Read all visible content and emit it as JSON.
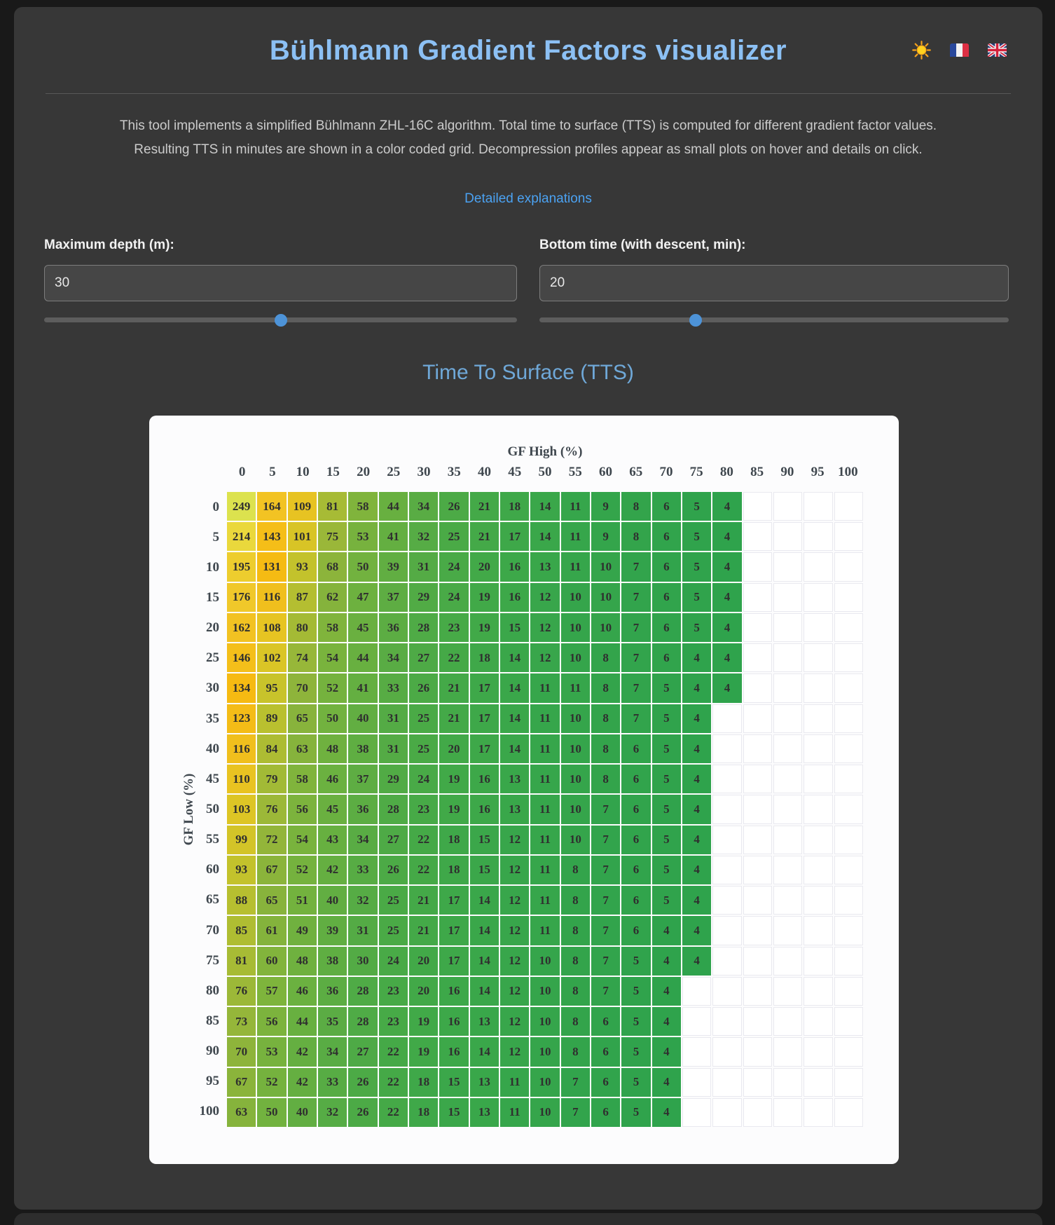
{
  "header": {
    "title": "Bühlmann Gradient Factors visualizer"
  },
  "intro": {
    "line1": "This tool implements a simplified Bühlmann ZHL-16C algorithm. Total time to surface (TTS) is computed for different gradient factor values.",
    "line2": "Resulting TTS in minutes are shown in a color coded grid. Decompression profiles appear as small plots on hover and details on click.",
    "link": "Detailed explanations"
  },
  "controls": {
    "depth": {
      "label": "Maximum depth (m):",
      "value": "30",
      "slider_fraction": 0.5
    },
    "bottom_time": {
      "label": "Bottom time (with descent, min):",
      "value": "20",
      "slider_fraction": 0.3333
    }
  },
  "chart_data": {
    "type": "heatmap",
    "title": "Time To Surface (TTS)",
    "xlabel": "GF High (%)",
    "ylabel": "GF Low (%)",
    "x_ticks": [
      0,
      5,
      10,
      15,
      20,
      25,
      30,
      35,
      40,
      45,
      50,
      55,
      60,
      65,
      70,
      75,
      80,
      85,
      90,
      95,
      100
    ],
    "y_ticks": [
      0,
      5,
      10,
      15,
      20,
      25,
      30,
      35,
      40,
      45,
      50,
      55,
      60,
      65,
      70,
      75,
      80,
      85,
      90,
      95,
      100
    ],
    "values_unit": "minutes",
    "values_by_row": [
      [
        249,
        164,
        109,
        81,
        58,
        44,
        34,
        26,
        21,
        18,
        14,
        11,
        9,
        8,
        6,
        5,
        4
      ],
      [
        214,
        143,
        101,
        75,
        53,
        41,
        32,
        25,
        21,
        17,
        14,
        11,
        9,
        8,
        6,
        5,
        4
      ],
      [
        195,
        131,
        93,
        68,
        50,
        39,
        31,
        24,
        20,
        16,
        13,
        11,
        10,
        7,
        6,
        5,
        4
      ],
      [
        176,
        116,
        87,
        62,
        47,
        37,
        29,
        24,
        19,
        16,
        12,
        10,
        10,
        7,
        6,
        5,
        4
      ],
      [
        162,
        108,
        80,
        58,
        45,
        36,
        28,
        23,
        19,
        15,
        12,
        10,
        10,
        7,
        6,
        5,
        4
      ],
      [
        146,
        102,
        74,
        54,
        44,
        34,
        27,
        22,
        18,
        14,
        12,
        10,
        8,
        7,
        6,
        4,
        4
      ],
      [
        134,
        95,
        70,
        52,
        41,
        33,
        26,
        21,
        17,
        14,
        11,
        11,
        8,
        7,
        5,
        4,
        4
      ],
      [
        123,
        89,
        65,
        50,
        40,
        31,
        25,
        21,
        17,
        14,
        11,
        10,
        8,
        7,
        5,
        4
      ],
      [
        116,
        84,
        63,
        48,
        38,
        31,
        25,
        20,
        17,
        14,
        11,
        10,
        8,
        6,
        5,
        4
      ],
      [
        110,
        79,
        58,
        46,
        37,
        29,
        24,
        19,
        16,
        13,
        11,
        10,
        8,
        6,
        5,
        4
      ],
      [
        103,
        76,
        56,
        45,
        36,
        28,
        23,
        19,
        16,
        13,
        11,
        10,
        7,
        6,
        5,
        4
      ],
      [
        99,
        72,
        54,
        43,
        34,
        27,
        22,
        18,
        15,
        12,
        11,
        10,
        7,
        6,
        5,
        4
      ],
      [
        93,
        67,
        52,
        42,
        33,
        26,
        22,
        18,
        15,
        12,
        11,
        8,
        7,
        6,
        5,
        4
      ],
      [
        88,
        65,
        51,
        40,
        32,
        25,
        21,
        17,
        14,
        12,
        11,
        8,
        7,
        6,
        5,
        4
      ],
      [
        85,
        61,
        49,
        39,
        31,
        25,
        21,
        17,
        14,
        12,
        11,
        8,
        7,
        6,
        4,
        4
      ],
      [
        81,
        60,
        48,
        38,
        30,
        24,
        20,
        17,
        14,
        12,
        10,
        8,
        7,
        5,
        4,
        4
      ],
      [
        76,
        57,
        46,
        36,
        28,
        23,
        20,
        16,
        14,
        12,
        10,
        8,
        7,
        5,
        4
      ],
      [
        73,
        56,
        44,
        35,
        28,
        23,
        19,
        16,
        13,
        12,
        10,
        8,
        6,
        5,
        4
      ],
      [
        70,
        53,
        42,
        34,
        27,
        22,
        19,
        16,
        14,
        12,
        10,
        8,
        6,
        5,
        4
      ],
      [
        67,
        52,
        42,
        33,
        26,
        22,
        18,
        15,
        13,
        11,
        10,
        7,
        6,
        5,
        4
      ],
      [
        63,
        50,
        40,
        32,
        26,
        22,
        18,
        15,
        13,
        11,
        10,
        7,
        6,
        5,
        4
      ]
    ],
    "colormap_anchors": [
      [
        4,
        "#2fa34c"
      ],
      [
        10,
        "#35a54b"
      ],
      [
        14,
        "#3aa74a"
      ],
      [
        20,
        "#42a948"
      ],
      [
        26,
        "#4caa46"
      ],
      [
        34,
        "#59ac44"
      ],
      [
        44,
        "#68b040"
      ],
      [
        52,
        "#75b23e"
      ],
      [
        58,
        "#80b43c"
      ],
      [
        63,
        "#86b33c"
      ],
      [
        70,
        "#8eb43b"
      ],
      [
        76,
        "#9cb838"
      ],
      [
        85,
        "#afbd32"
      ],
      [
        93,
        "#c3c22c"
      ],
      [
        103,
        "#ddc525"
      ],
      [
        110,
        "#e9c321"
      ],
      [
        116,
        "#f0bf1d"
      ],
      [
        123,
        "#f4bc17"
      ],
      [
        134,
        "#f6ba12"
      ],
      [
        146,
        "#f4bf1a"
      ],
      [
        162,
        "#f2c222"
      ],
      [
        176,
        "#f0c82a"
      ],
      [
        195,
        "#edcd2e"
      ],
      [
        214,
        "#ead83c"
      ],
      [
        249,
        "#dce24e"
      ]
    ],
    "legend_position": "none",
    "grid": true
  },
  "colors": {
    "accent_title": "#8cc0f4",
    "accent_heading": "#6fa8d8",
    "accent_link": "#4ba2f2",
    "slider_thumb": "#4d93d8",
    "panel_bg": "#fcfcfd"
  }
}
